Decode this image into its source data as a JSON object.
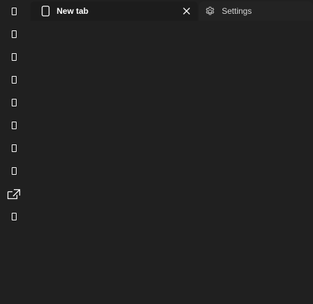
{
  "tabs": [
    {
      "label": "New tab",
      "icon": "document-icon",
      "active": true
    },
    {
      "label": "Settings",
      "icon": "gear-icon",
      "active": false
    }
  ],
  "side_rail": {
    "icons": [
      "placeholder-glyph-icon",
      "placeholder-glyph-icon",
      "placeholder-glyph-icon",
      "placeholder-glyph-icon",
      "placeholder-glyph-icon",
      "placeholder-glyph-icon",
      "placeholder-glyph-icon",
      "placeholder-glyph-icon",
      "open-in-new-window-icon",
      "placeholder-glyph-icon"
    ]
  },
  "colors": {
    "background": "#202020",
    "foreground": "#ffffff",
    "inactive_text": "#d6d6d6"
  }
}
